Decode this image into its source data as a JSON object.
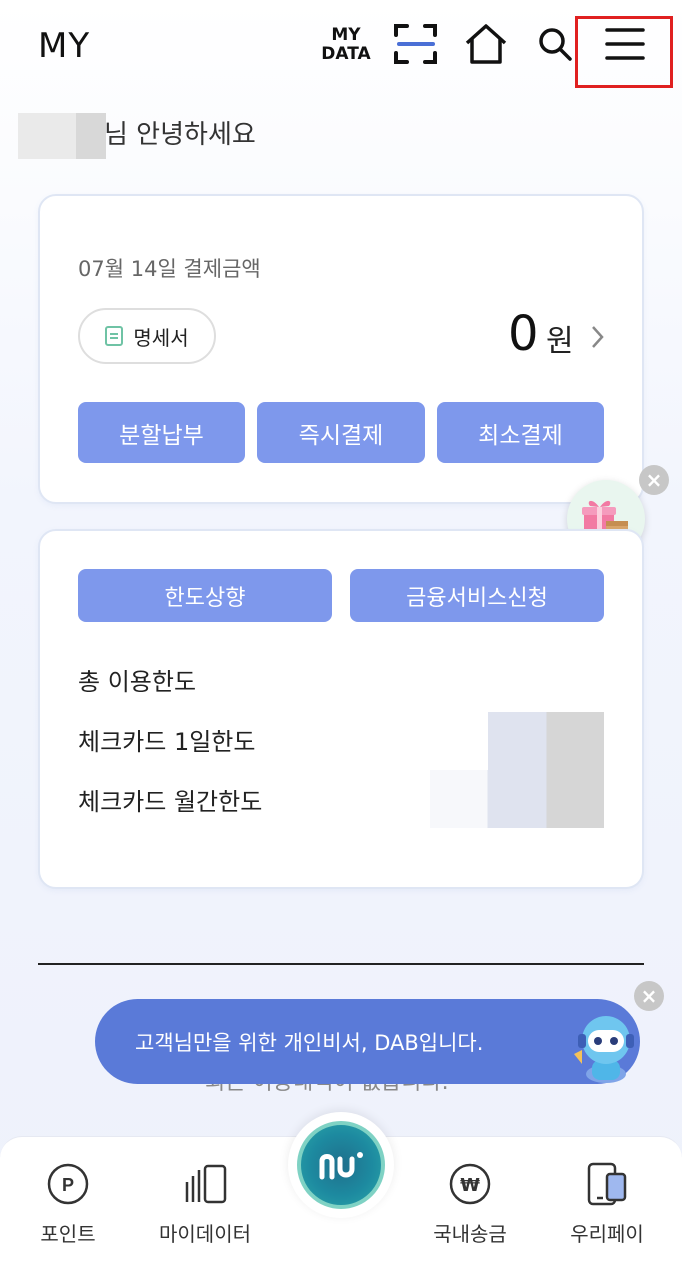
{
  "header": {
    "title": "MY",
    "mydata_line1": "MY",
    "mydata_line2": "DATA",
    "icons": [
      "mydata-icon",
      "scan-icon",
      "home-icon",
      "search-icon",
      "menu-icon"
    ]
  },
  "greeting": "님 안녕하세요",
  "payment_card": {
    "date_label": "07월 14일 결제금액",
    "statement_label": "명세서",
    "amount": "0",
    "amount_unit": "원",
    "buttons": [
      "분할납부",
      "즉시결제",
      "최소결제"
    ]
  },
  "limit_card": {
    "buttons": [
      "한도상향",
      "금융서비스신청"
    ],
    "labels": [
      "총 이용한도",
      "체크카드 1일한도",
      "체크카드 월간한도"
    ]
  },
  "notice_text": "최근 이용내역이 없습니다.",
  "dab_banner": "고객님만을 위한 개인비서, DAB입니다.",
  "close_symbol": "×",
  "bottom_nav": {
    "items": [
      {
        "label": "포인트",
        "icon": "point-icon"
      },
      {
        "label": "마이데이터",
        "icon": "mydata-bars-icon"
      },
      {
        "label": "국내송금",
        "icon": "won-transfer-icon"
      },
      {
        "label": "우리페이",
        "icon": "woori-pay-icon"
      }
    ],
    "center_icon": "woori-logo-icon"
  },
  "colors": {
    "accent": "#7e98ec",
    "dab": "#5a7ad8",
    "highlight": "#e02020"
  }
}
